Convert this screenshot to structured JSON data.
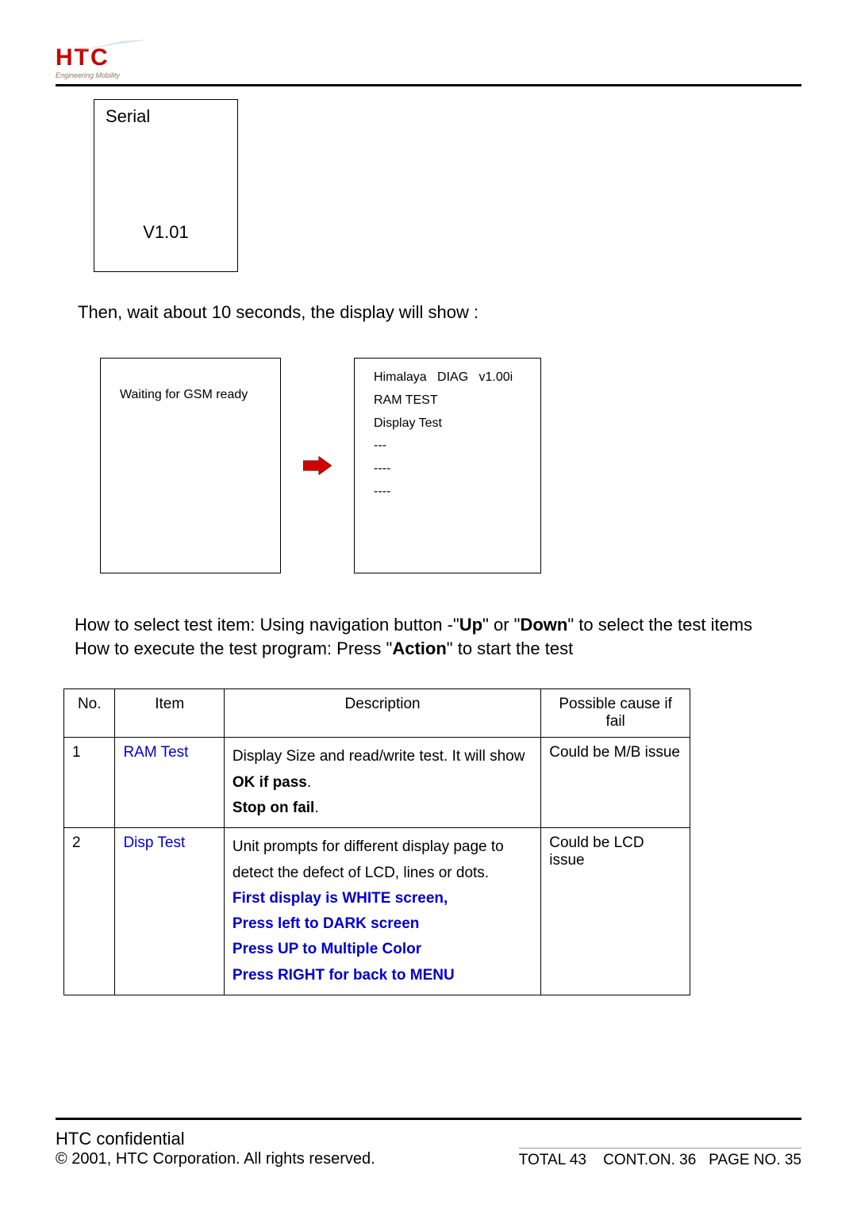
{
  "logo": {
    "brand": "HTC",
    "tagline": "Engineering Mobility"
  },
  "serial_box": {
    "title": "Serial",
    "version": "V1.01"
  },
  "wait_text": "Then, wait about 10 seconds, the display will show :",
  "screen_left": {
    "line1": "Waiting for GSM ready"
  },
  "screen_right": {
    "line1": "Himalaya   DIAG   v1.00i",
    "line2": "RAM TEST",
    "line3": "Display Test",
    "line4": "---",
    "line5": "----",
    "line6": "----"
  },
  "instructions": {
    "line1_prefix": "How to select test item: Using navigation button -\"",
    "up": "Up",
    "line1_mid1": "\" or \"",
    "down": "Down",
    "line1_suffix": "\" to select the test items",
    "line2_prefix": "How to execute the test program: Press \"",
    "action": "Action",
    "line2_suffix": "\" to start the test"
  },
  "table": {
    "headers": {
      "no": "No.",
      "item": "Item",
      "desc": "Description",
      "cause": "Possible cause if fail"
    },
    "rows": [
      {
        "no": "1",
        "item": "RAM Test",
        "desc_pre": "Display Size and read/write test. It will show ",
        "desc_bold": "OK if pass",
        "desc_post": ".",
        "stop_bold": "Stop on fail",
        "stop_post": ".",
        "cause": "Could be M/B issue"
      },
      {
        "no": "2",
        "item": "Disp Test",
        "desc_text": "Unit prompts for different display page to detect the defect of LCD, lines or dots.",
        "blue1": "First display is WHITE screen,",
        "blue2": "Press left to DARK screen",
        "blue3": "Press UP to Multiple Color",
        "blue4": "Press RIGHT for back to MENU",
        "cause": "Could be LCD issue"
      }
    ]
  },
  "footer": {
    "confidential": "HTC confidential",
    "copyright": "© 2001, HTC Corporation. All rights reserved.",
    "total": "TOTAL 43",
    "cont": "CONT.ON. 36",
    "page": "PAGE NO. 35"
  }
}
